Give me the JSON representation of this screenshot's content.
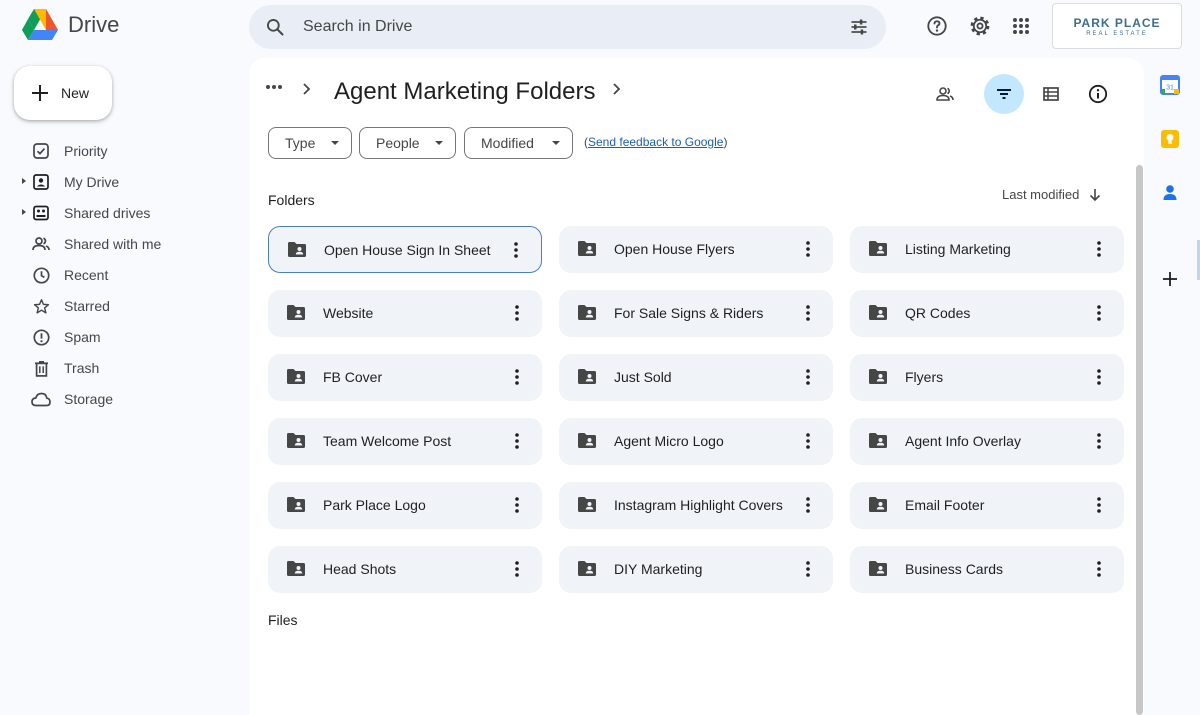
{
  "app": {
    "name": "Drive",
    "logo_icon": "google-drive-logo"
  },
  "search": {
    "placeholder": "Search in Drive",
    "value": ""
  },
  "header_icons": [
    "help-icon",
    "settings-icon",
    "apps-grid-icon"
  ],
  "brand": {
    "line1": "PARK PLACE",
    "line2": "REAL ESTATE"
  },
  "sidebar": {
    "new_label": "New",
    "items": [
      {
        "label": "Priority",
        "icon": "priority-icon",
        "expandable": false
      },
      {
        "label": "My Drive",
        "icon": "my-drive-icon",
        "expandable": true
      },
      {
        "label": "Shared drives",
        "icon": "shared-drives-icon",
        "expandable": true
      },
      {
        "label": "Shared with me",
        "icon": "shared-with-me-icon",
        "expandable": false
      },
      {
        "label": "Recent",
        "icon": "clock-icon",
        "expandable": false
      },
      {
        "label": "Starred",
        "icon": "star-icon",
        "expandable": false
      },
      {
        "label": "Spam",
        "icon": "spam-icon",
        "expandable": false
      },
      {
        "label": "Trash",
        "icon": "trash-icon",
        "expandable": false
      },
      {
        "label": "Storage",
        "icon": "cloud-icon",
        "expandable": false
      }
    ]
  },
  "breadcrumb": {
    "title": "Agent Marketing Folders"
  },
  "filters": {
    "type": "Type",
    "people": "People",
    "modified": "Modified",
    "feedback_prefix": "(",
    "feedback_link": "Send feedback to Google",
    "feedback_suffix": ")"
  },
  "sections": {
    "folders": "Folders",
    "files": "Files",
    "sort_label": "Last modified"
  },
  "folders": [
    "Open House Sign In Sheet",
    "Open House Flyers",
    "Listing Marketing",
    "Website",
    "For Sale Signs & Riders",
    "QR Codes",
    "FB Cover",
    "Just Sold",
    "Flyers",
    "Team Welcome Post",
    "Agent Micro Logo",
    "Agent Info Overlay",
    "Park Place Logo",
    "Instagram Highlight Covers",
    "Email Footer",
    "Head Shots",
    "DIY Marketing",
    "Business Cards"
  ],
  "selected_folder_index": 0,
  "colors": {
    "accent": "#0b57d0",
    "active_tool": "#c2e7ff",
    "folder_bg": "#f0f4f9",
    "page_bg": "#f8fafd"
  }
}
